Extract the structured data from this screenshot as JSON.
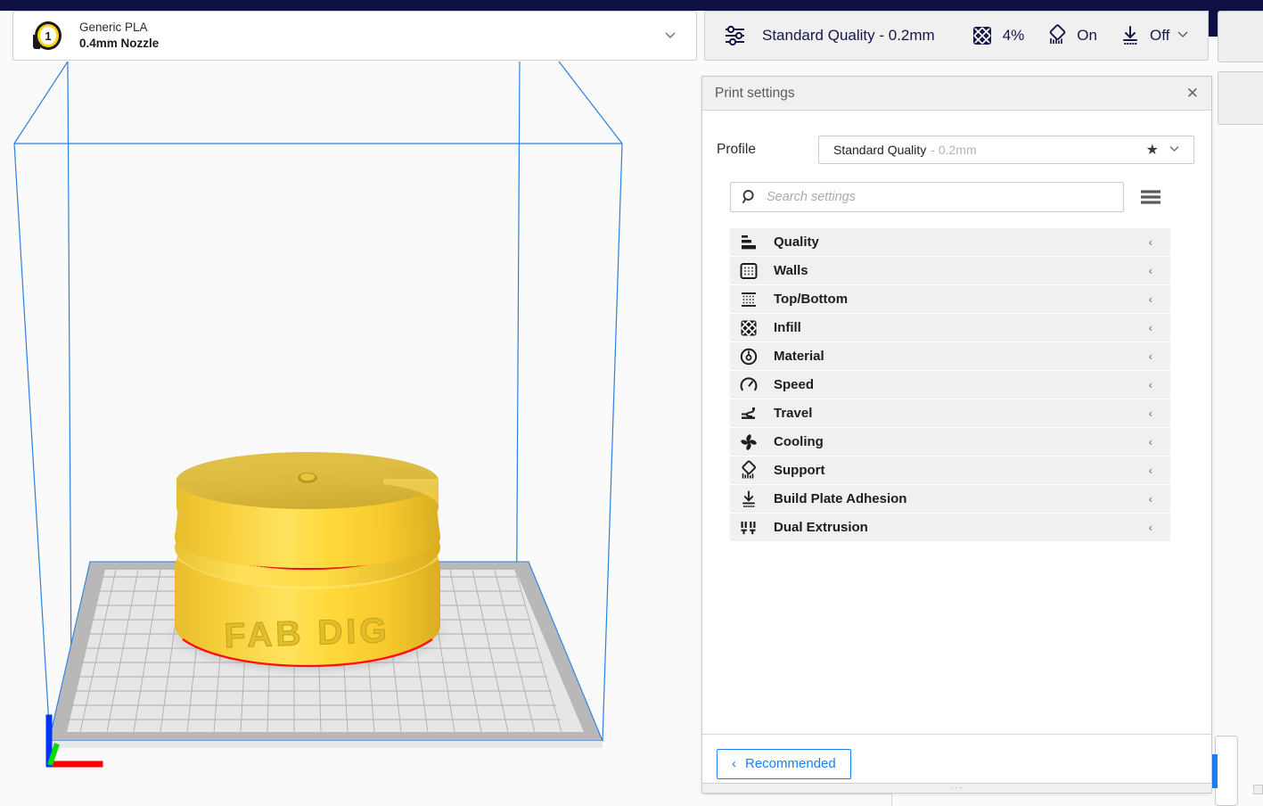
{
  "app": {
    "accent_blue": "#1c7ef3",
    "navy": "#0e1044",
    "model_gold": "#ffd93b"
  },
  "extruder": {
    "number": "1",
    "material": "Generic PLA",
    "nozzle": "0.4mm Nozzle",
    "chevron": "chevron-down-icon"
  },
  "toolbar": {
    "profile_label": "Standard Quality - 0.2mm",
    "infill_value": "4%",
    "support_value": "On",
    "adhesion_value": "Off",
    "icons": {
      "sliders": "print-setup-sliders-icon",
      "infill": "infill-icon",
      "support": "support-icon",
      "adhesion": "build-plate-adhesion-icon",
      "expand": "chevron-down-icon"
    }
  },
  "print_settings": {
    "title": "Print settings",
    "close_label": "✕",
    "profile": {
      "label": "Profile",
      "value_name": "Standard Quality",
      "value_suffix": "- 0.2mm",
      "star": "★",
      "chevron": "∨"
    },
    "search": {
      "placeholder": "Search settings",
      "value": ""
    },
    "menu_icon": "hamburger-menu-icon",
    "categories": [
      {
        "label": "Quality",
        "icon": "quality-icon",
        "chevron": "‹",
        "expanded": false
      },
      {
        "label": "Walls",
        "icon": "walls-icon",
        "chevron": "‹",
        "expanded": false
      },
      {
        "label": "Top/Bottom",
        "icon": "top-bottom-icon",
        "chevron": "‹",
        "expanded": false
      },
      {
        "label": "Infill",
        "icon": "infill-icon",
        "chevron": "‹",
        "expanded": false
      },
      {
        "label": "Material",
        "icon": "material-icon",
        "chevron": "‹",
        "expanded": false
      },
      {
        "label": "Speed",
        "icon": "speed-icon",
        "chevron": "‹",
        "expanded": false
      },
      {
        "label": "Travel",
        "icon": "travel-icon",
        "chevron": "‹",
        "expanded": false
      },
      {
        "label": "Cooling",
        "icon": "cooling-fan-icon",
        "chevron": "‹",
        "expanded": false
      },
      {
        "label": "Support",
        "icon": "support-icon",
        "chevron": "‹",
        "expanded": false
      },
      {
        "label": "Build Plate Adhesion",
        "icon": "adhesion-icon",
        "chevron": "‹",
        "expanded": false
      },
      {
        "label": "Dual Extrusion",
        "icon": "dual-extrusion-icon",
        "chevron": "‹",
        "expanded": false
      }
    ],
    "footer": {
      "recommended_label": "Recommended",
      "recommended_chevron": "‹"
    },
    "grip_dots": "···"
  },
  "viewport": {
    "model_text": "FAB DIG",
    "axes": {
      "x_color": "#ff0000",
      "y_color": "#00dd00",
      "z_color": "#0033ff"
    },
    "build_volume_color": "#2a7fe0",
    "plate_color": "#c9c9c9"
  }
}
